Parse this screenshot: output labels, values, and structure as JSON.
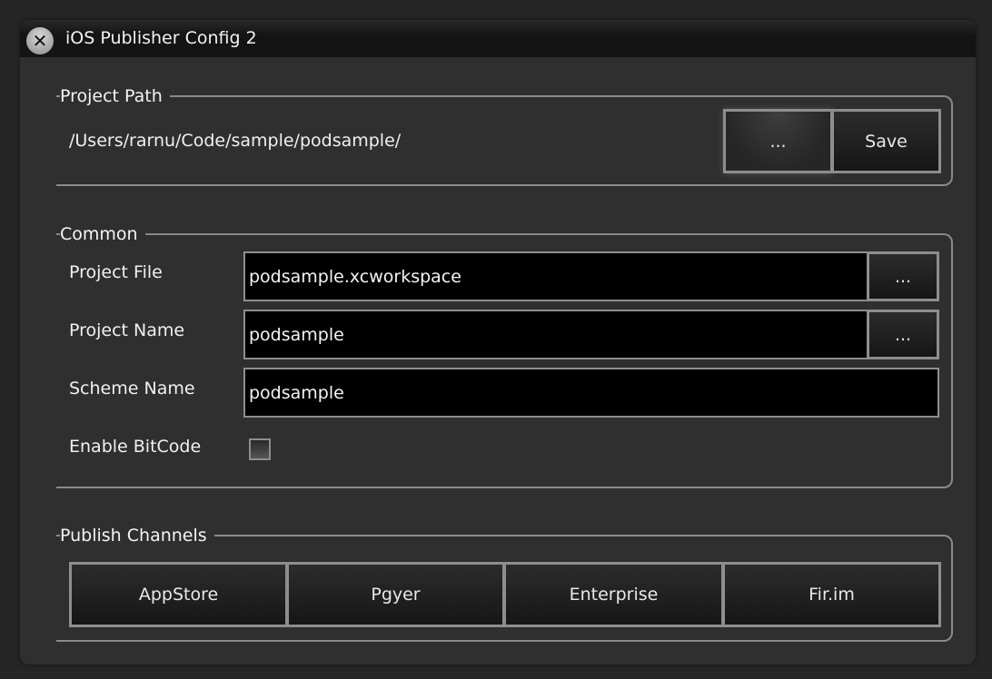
{
  "window": {
    "title": "iOS Publisher Config 2",
    "close_icon": "close-icon"
  },
  "project_path": {
    "label": "Project Path",
    "path": "/Users/rarnu/Code/sample/podsample/",
    "browse_label": "...",
    "save_label": "Save"
  },
  "common": {
    "label": "Common",
    "project_file": {
      "label": "Project File",
      "value": "podsample.xcworkspace",
      "browse_label": "..."
    },
    "project_name": {
      "label": "Project Name",
      "value": "podsample",
      "browse_label": "..."
    },
    "scheme_name": {
      "label": "Scheme Name",
      "value": "podsample"
    },
    "bitcode": {
      "label": "Enable BitCode",
      "checked": false
    }
  },
  "publish": {
    "label": "Publish Channels",
    "channels": [
      "AppStore",
      "Pgyer",
      "Enterprise",
      "Fir.im"
    ]
  }
}
